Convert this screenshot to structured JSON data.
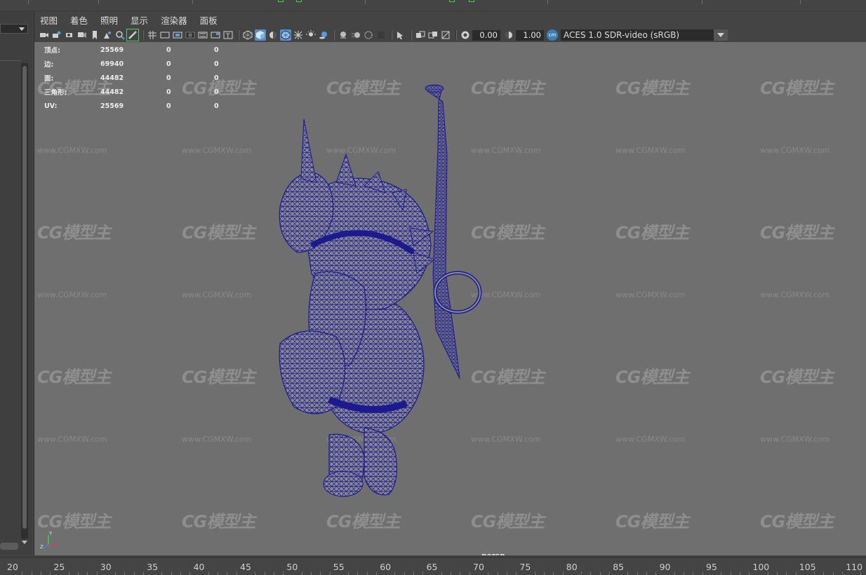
{
  "menu": [
    "视图",
    "着色",
    "照明",
    "显示",
    "渲染器",
    "面板"
  ],
  "toolbar": {
    "exposure_value": "0.00",
    "gamma_value": "1.00",
    "color_badge": "cm",
    "color_space": "ACES 1.0 SDR-video (sRGB)"
  },
  "stats": [
    {
      "label": "顶点:",
      "v1": "25569",
      "v2": "0",
      "v3": "0"
    },
    {
      "label": "边:",
      "v1": "69940",
      "v2": "0",
      "v3": "0"
    },
    {
      "label": "面:",
      "v1": "44482",
      "v2": "0",
      "v3": "0"
    },
    {
      "label": "三角形:",
      "v1": "44482",
      "v2": "0",
      "v3": "0"
    },
    {
      "label": "UV:",
      "v1": "25569",
      "v2": "0",
      "v3": "0"
    }
  ],
  "watermark": {
    "logo": "CG模型主",
    "url": "www.CGMXW.com"
  },
  "viewport": {
    "camera_label": "persp",
    "shading": "wireframe-on-shaded",
    "wire_color": "#1c1a8e",
    "background_color": "#6f6f6f"
  },
  "axis": {
    "y": "Y",
    "z": "Z"
  },
  "timeline": {
    "numbers": [
      "20",
      "25",
      "30",
      "35",
      "40",
      "45",
      "50",
      "55",
      "60",
      "65",
      "70",
      "75",
      "80",
      "85",
      "90",
      "95",
      "100",
      "105",
      "110"
    ]
  }
}
